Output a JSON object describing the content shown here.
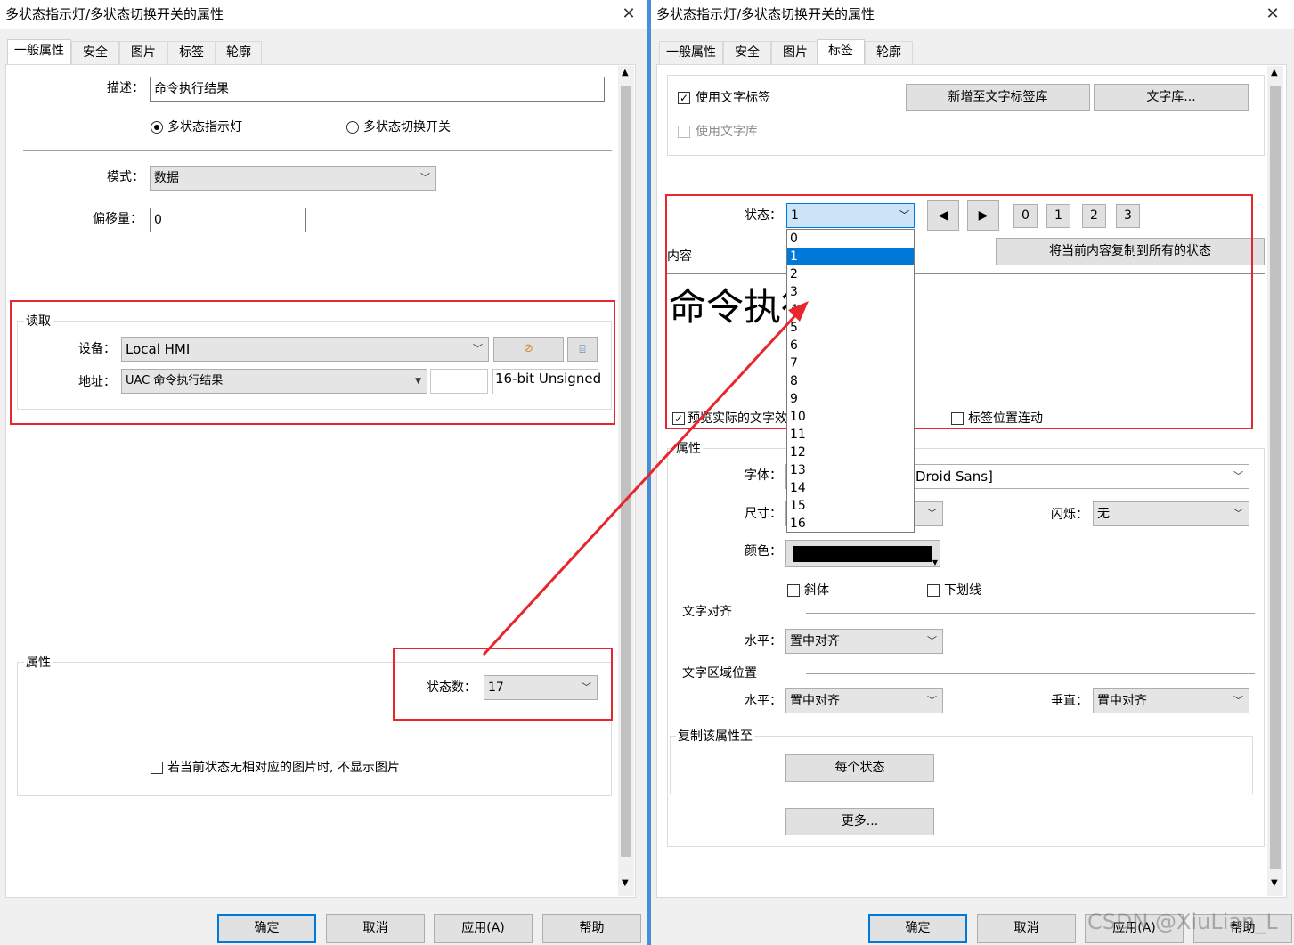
{
  "left": {
    "title": "多状态指示灯/多状态切换开关的属性",
    "tabs": [
      "一般属性",
      "安全",
      "图片",
      "标签",
      "轮廓"
    ],
    "desc_label": "描述：",
    "desc_value": "命令执行结果",
    "radio1": "多状态指示灯",
    "radio2": "多状态切换开关",
    "mode_label": "模式：",
    "mode_value": "数据",
    "offset_label": "偏移量：",
    "offset_value": "0",
    "read_group": "读取",
    "device_label": "设备：",
    "device_value": "Local HMI",
    "addr_label": "地址：",
    "addr_value": "UAC 命令执行结果",
    "addr_type": "16-bit Unsigned",
    "attr_group": "属性",
    "state_count_label": "状态数：",
    "state_count_value": "17",
    "no_picture_label": "若当前状态无相对应的图片时, 不显示图片",
    "buttons": {
      "ok": "确定",
      "cancel": "取消",
      "apply": "应用(A)",
      "help": "帮助"
    }
  },
  "right": {
    "title": "多状态指示灯/多状态切换开关的属性",
    "tabs": [
      "一般属性",
      "安全",
      "图片",
      "标签",
      "轮廓"
    ],
    "use_text_label": "使用文字标签",
    "use_text_lib": "使用文字库",
    "add_to_lib": "新增至文字标签库",
    "text_lib": "文字库...",
    "state_label": "状态：",
    "state_value": "1",
    "state_buttons": [
      "0",
      "1",
      "2",
      "3"
    ],
    "content_label": "内容",
    "copy_all": "将当前内容复制到所有的状态",
    "content_text": "命令执行",
    "preview_label": "预览实际的文字效",
    "label_pos_link": "标签位置连动",
    "attr_group": "属性",
    "font_label": "字体：",
    "font_value": "Droid Sans]",
    "size_label": "尺寸：",
    "blink_label": "闪烁：",
    "blink_value": "无",
    "color_label": "颜色：",
    "italic_label": "斜体",
    "underline_label": "下划线",
    "text_align_group": "文字对齐",
    "h_align_label": "水平：",
    "h_align_value": "置中对齐",
    "region_group": "文字区域位置",
    "region_h_label": "水平：",
    "region_h_value": "置中对齐",
    "region_v_label": "垂直：",
    "region_v_value": "置中对齐",
    "copy_attr_group": "复制该属性至",
    "each_state": "每个状态",
    "more": "更多...",
    "dropdown_items": [
      "0",
      "1",
      "2",
      "3",
      "4",
      "5",
      "6",
      "7",
      "8",
      "9",
      "10",
      "11",
      "12",
      "13",
      "14",
      "15",
      "16"
    ],
    "dropdown_selected": "1",
    "buttons": {
      "ok": "确定",
      "cancel": "取消",
      "apply": "应用(A)",
      "help": "帮助"
    },
    "watermark": "CSDN @XiuLian_L"
  },
  "colors": {
    "annotation_red": "#e8262d",
    "selection_blue": "#0078d7"
  }
}
